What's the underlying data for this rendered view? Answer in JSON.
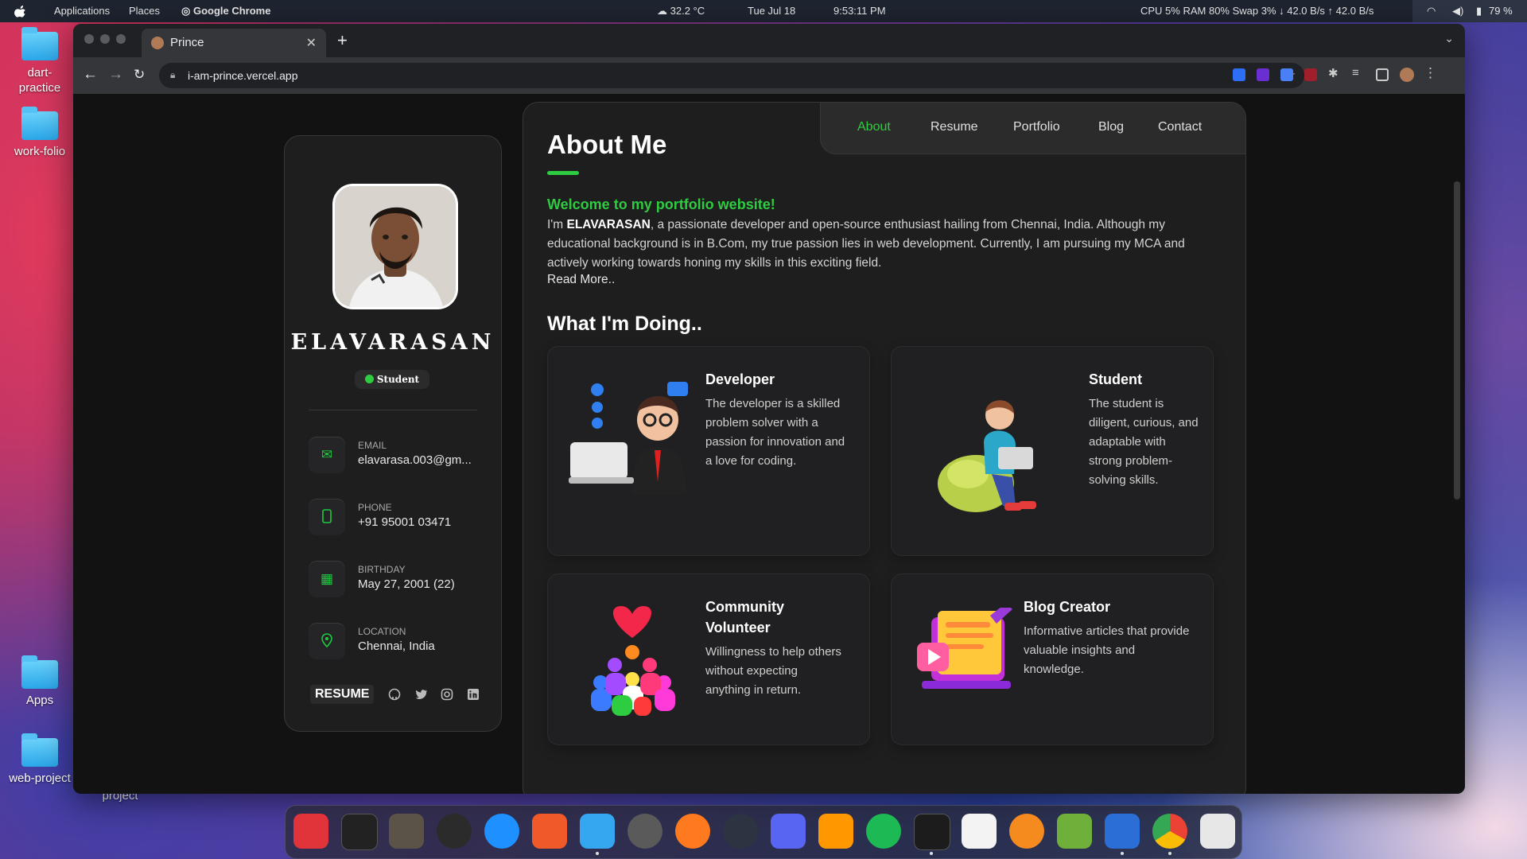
{
  "menubar": {
    "applications": "Applications",
    "places": "Places",
    "active_app": "Google Chrome",
    "weather": "32.2 °C",
    "date": "Tue Jul 18",
    "time": "9:53:11 PM",
    "stats": "CPU  5% RAM  80% Swap  3% ↓ 42.0 B/s ↑ 42.0 B/s",
    "battery": "79 %"
  },
  "desktop": {
    "icons": [
      "dart-\npractice",
      "work-folio",
      "Apps",
      "web-project"
    ],
    "partial_label": "project"
  },
  "browser": {
    "tab_title": "Prince",
    "url": "i-am-prince.vercel.app"
  },
  "profile": {
    "name": "ELAVARASAN",
    "badge": "Student",
    "contacts": [
      {
        "label": "EMAIL",
        "value": "elavarasa.003@gm..."
      },
      {
        "label": "PHONE",
        "value": "+91 95001 03471"
      },
      {
        "label": "BIRTHDAY",
        "value": "May 27, 2001 (22)"
      },
      {
        "label": "LOCATION",
        "value": "Chennai, India"
      }
    ],
    "resume_button": "RESUME"
  },
  "nav": {
    "items": [
      "About",
      "Resume",
      "Portfolio",
      "Blog",
      "Contact"
    ],
    "active": "About"
  },
  "about": {
    "title": "About Me",
    "welcome": "Welcome to my portfolio website!",
    "intro_prefix": "I'm ",
    "intro_name": "ELAVARASAN",
    "intro_rest": ", a passionate developer and open-source enthusiast hailing from Chennai, India. Although my educational background is in B.Com, my true passion lies in web development. Currently, I am pursuing my MCA and actively working towards honing my skills in this exciting field.",
    "read_more": "Read More..",
    "doing_title": "What I'm Doing.."
  },
  "services": [
    {
      "title": "Developer",
      "text": "The developer is a skilled problem solver with a passion for innovation and a love for coding."
    },
    {
      "title": "Student",
      "text": "The student is diligent, curious, and adaptable with strong problem-solving skills."
    },
    {
      "title": "Community\nVolunteer",
      "text": "Willingness to help others without expecting anything in return."
    },
    {
      "title": "Blog Creator",
      "text": "Informative articles that provide valuable insights and knowledge."
    }
  ],
  "colors": {
    "accent": "#2ecc40",
    "card": "#1e1e1f",
    "background": "#121212"
  },
  "icons": [
    "email-icon",
    "phone-icon",
    "calendar-icon",
    "location-icon",
    "github-icon",
    "twitter-icon",
    "instagram-icon",
    "linkedin-icon"
  ]
}
